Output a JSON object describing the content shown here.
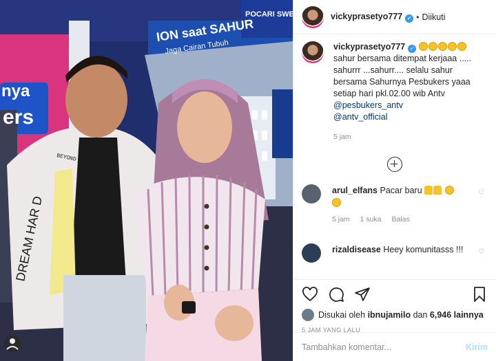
{
  "post": {
    "photo_alt": "",
    "banner": {
      "line1": "ION saat SAHUR",
      "line2": "Jaga Cairan Tubuh",
      "brand": "POCARI SWEAT",
      "side_text": "nya",
      "side_text2": "ers",
      "jacket_text": "DREAM HAR D",
      "patch_text": "BEYOND TO NO ONE"
    }
  },
  "header": {
    "username": "vickyprasetyo777",
    "follow_status": "Diikuti"
  },
  "caption": {
    "username": "vickyprasetyo777",
    "text": "sahur bersama ditempat kerjaaa ..... sahurrr ...sahurr.... selalu sahur bersama Sahurnya Pesbukers yaaa setiap hari pkl.02.00 wib Antv",
    "mention1": "@pesbukers_antv",
    "mention2": "@antv_official",
    "time": "5 jam"
  },
  "comments": [
    {
      "username": "arul_elfans",
      "text": "Pacar baru",
      "time": "5 jam",
      "likes": "1 suka",
      "reply": "Balas"
    },
    {
      "username": "rizaldisease",
      "text": "Heey komunitasss !!!"
    }
  ],
  "actions": {
    "liked_by_prefix": "Disukai oleh",
    "liked_by_user": "ibnujamilo",
    "liked_by_and": "dan",
    "liked_by_count": "6,946 lainnya",
    "posted_ago": "5 JAM YANG LALU"
  },
  "comment_box": {
    "placeholder": "Tambahkan komentar...",
    "send_label": "Kirim"
  },
  "colors": {
    "verified": "#3897f0",
    "link": "#00376b",
    "send_disabled": "#b2dffc",
    "muted": "#8e8e8e"
  }
}
